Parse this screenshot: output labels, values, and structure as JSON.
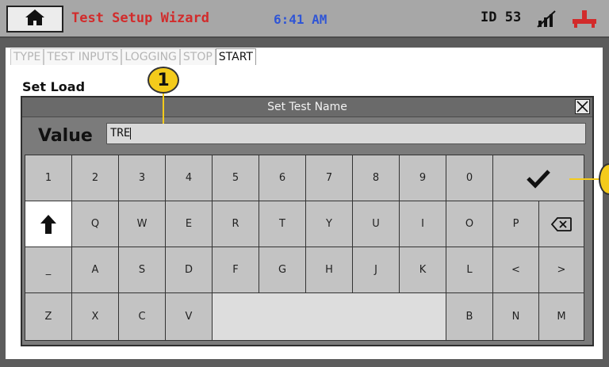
{
  "header": {
    "title": "Test Setup Wizard",
    "time": "6:41 AM",
    "device_id": "ID 53",
    "home_icon": "home-icon",
    "mute_icon": "network-disconnected-icon",
    "status_icon": "fixture-icon",
    "title_color": "#d22b2b",
    "time_color": "#2f55d6"
  },
  "tabs": [
    {
      "label": "TYPE",
      "active": false
    },
    {
      "label": "TEST INPUTS",
      "active": false
    },
    {
      "label": "LOGGING",
      "active": false
    },
    {
      "label": "STOP",
      "active": false
    },
    {
      "label": "START",
      "active": true
    }
  ],
  "section": {
    "label": "Set Load"
  },
  "dialog": {
    "title": "Set Test Name",
    "close_icon": "close-icon",
    "value_label": "Value",
    "value": "TRE"
  },
  "keyboard": {
    "rows": [
      [
        "1",
        "2",
        "3",
        "4",
        "5",
        "6",
        "7",
        "8",
        "9",
        "0"
      ],
      [
        "Q",
        "W",
        "E",
        "R",
        "T",
        "Y",
        "U",
        "I",
        "O",
        "P"
      ],
      [
        "_",
        "A",
        "S",
        "D",
        "F",
        "G",
        "H",
        "J",
        "K",
        "L",
        "<",
        ">"
      ],
      [
        "Z",
        "X",
        "C",
        "V",
        "B",
        "N",
        "M"
      ]
    ],
    "enter_icon": "checkmark-icon",
    "shift_icon": "shift-arrow-icon",
    "backspace_icon": "backspace-icon"
  },
  "callouts": [
    {
      "label": "1",
      "color": "#f4cb1b"
    },
    {
      "label": "",
      "color": "#f4cb1b"
    }
  ]
}
